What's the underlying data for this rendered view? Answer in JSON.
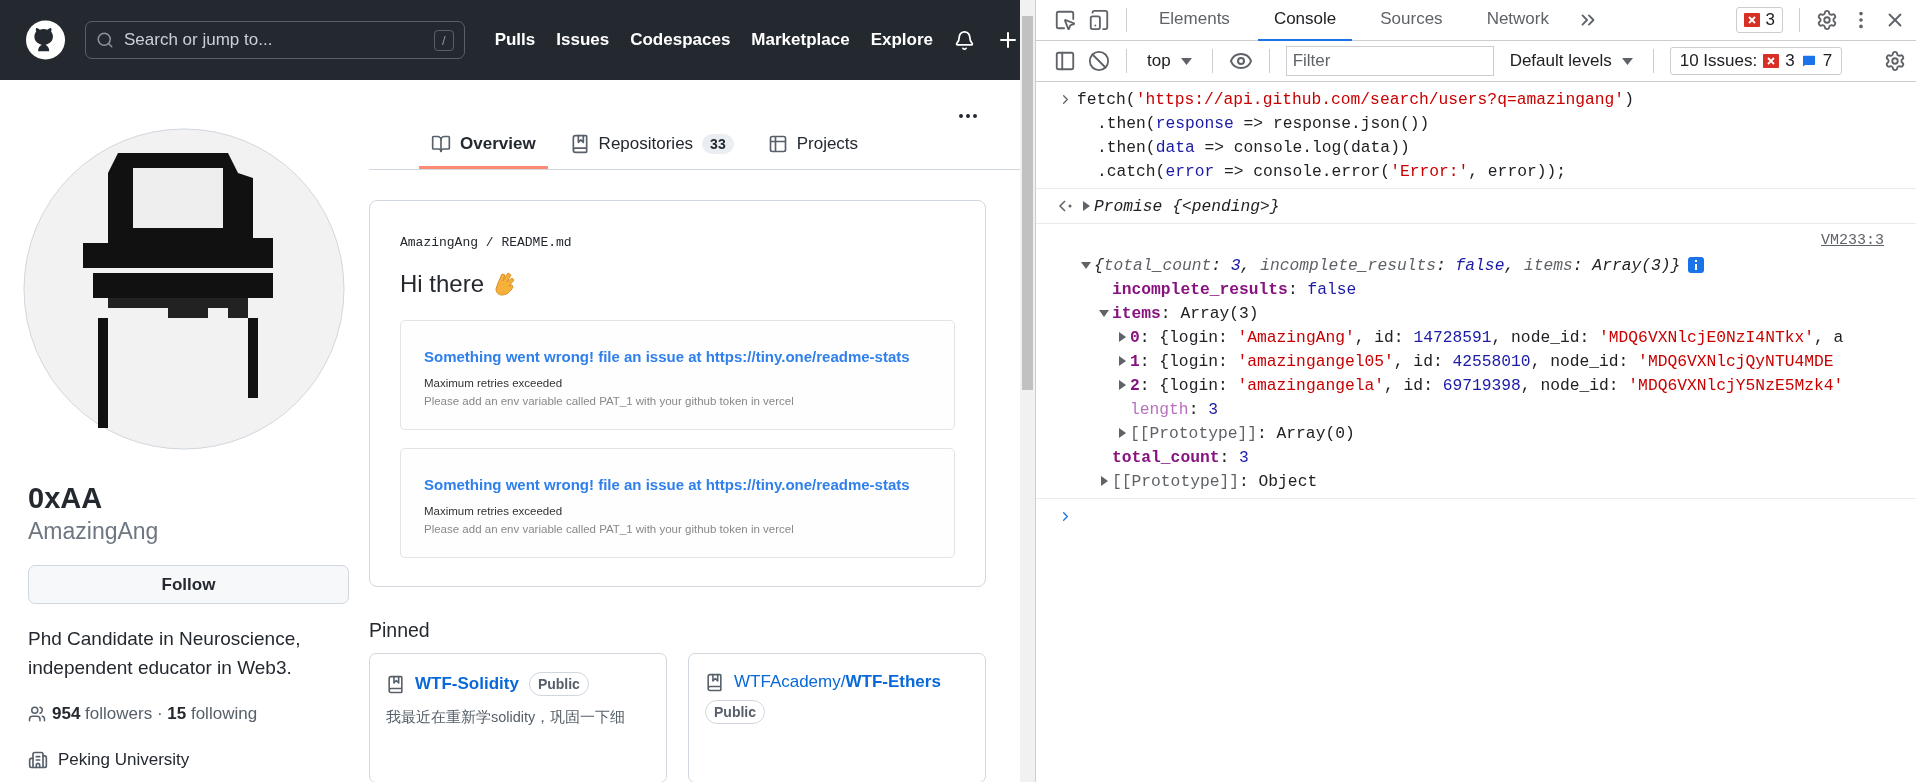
{
  "github": {
    "header": {
      "search_placeholder": "Search or jump to...",
      "search_key": "/",
      "nav": [
        "Pulls",
        "Issues",
        "Codespaces",
        "Marketplace",
        "Explore"
      ]
    },
    "tabs": [
      {
        "label": "Overview",
        "kind": "book",
        "selected": true
      },
      {
        "label": "Repositories",
        "kind": "repo",
        "count": "33",
        "selected": false
      },
      {
        "label": "Projects",
        "kind": "table",
        "selected": false
      }
    ],
    "profile": {
      "name": "0xAA",
      "login": "AmazingAng",
      "follow_button": "Follow",
      "bio": "Phd Candidate in Neuroscience, independent educator in Web3.",
      "follow_stats": "**954** followers · **15** following",
      "organization": "Peking University"
    },
    "readme": {
      "path": "AmazingAng / README.md",
      "heading": "Hi there",
      "stat_cards": [
        {
          "title": "Something went wrong! file an issue at https://tiny.one/readme-stats",
          "message": "Maximum retries exceeded",
          "hint": "Please add an env variable called PAT_1 with your github token in vercel"
        },
        {
          "title": "Something went wrong! file an issue at https://tiny.one/readme-stats",
          "message": "Maximum retries exceeded",
          "hint": "Please add an env variable called PAT_1 with your github token in vercel"
        }
      ]
    },
    "pinned": {
      "title": "Pinned",
      "repos": [
        {
          "name": "WTF-Solidity",
          "badge": "Public",
          "description": "我最近在重新学solidity，巩固一下细"
        },
        {
          "owner": "WTFAcademy/",
          "name": "WTF-Ethers",
          "badge": "Public"
        }
      ]
    }
  },
  "devtools": {
    "tabs": [
      {
        "label": "Elements",
        "selected": false
      },
      {
        "label": "Console",
        "selected": true
      },
      {
        "label": "Sources",
        "selected": false
      },
      {
        "label": "Network",
        "selected": false
      }
    ],
    "error_count": "3",
    "context": "top",
    "filter_placeholder": "Filter",
    "levels": "Default levels",
    "issues": {
      "label": "10 Issues:",
      "errors": "3",
      "messages": "7"
    },
    "console": {
      "command": [
        [
          {
            "text": "fetch(",
            "kind": "plain"
          },
          {
            "text": "'https://api.github.com/search/users?q=amazingang'",
            "kind": "string"
          },
          {
            "text": ")",
            "kind": "plain"
          }
        ],
        [
          {
            "text": ".then(",
            "kind": "plain"
          },
          {
            "text": "response",
            "kind": "param"
          },
          {
            "text": " => response.json())",
            "kind": "plain"
          }
        ],
        [
          {
            "text": ".then(",
            "kind": "plain"
          },
          {
            "text": "data",
            "kind": "param"
          },
          {
            "text": " => console.log(data))",
            "kind": "plain"
          }
        ],
        [
          {
            "text": ".catch(",
            "kind": "plain"
          },
          {
            "text": "error",
            "kind": "param"
          },
          {
            "text": " => console.error(",
            "kind": "plain"
          },
          {
            "text": "'Error:'",
            "kind": "string"
          },
          {
            "text": ", error));",
            "kind": "plain"
          }
        ]
      ],
      "result": {
        "expanded": false,
        "tokens": [
          {
            "text": "Promise {<pending>}",
            "kind": "p-plain"
          }
        ]
      },
      "log": {
        "source": "VM233:3",
        "tree": {
          "expanded": true,
          "info": true,
          "tokens": [
            {
              "text": "{",
              "kind": "p-plain"
            },
            {
              "text": "total_count",
              "kind": "p-key"
            },
            {
              "text": ": ",
              "kind": "p-plain"
            },
            {
              "text": "3",
              "kind": "p-num"
            },
            {
              "text": ", ",
              "kind": "p-plain"
            },
            {
              "text": "incomplete_results",
              "kind": "p-key"
            },
            {
              "text": ": ",
              "kind": "p-plain"
            },
            {
              "text": "false",
              "kind": "p-num"
            },
            {
              "text": ", ",
              "kind": "p-plain"
            },
            {
              "text": "items",
              "kind": "p-key"
            },
            {
              "text": ": Array(3)}",
              "kind": "p-plain"
            }
          ],
          "children": [
            {
              "tokens": [
                {
                  "text": "incomplete_results",
                  "kind": "prop"
                },
                {
                  "text": ": ",
                  "kind": "plain"
                },
                {
                  "text": "false",
                  "kind": "number"
                }
              ]
            },
            {
              "expanded": true,
              "tokens": [
                {
                  "text": "items",
                  "kind": "prop"
                },
                {
                  "text": ": Array(3)",
                  "kind": "plain"
                }
              ],
              "children": [
                {
                  "expanded": false,
                  "tokens": [
                    {
                      "text": "0",
                      "kind": "prop"
                    },
                    {
                      "text": ": {login: ",
                      "kind": "plain"
                    },
                    {
                      "text": "'AmazingAng'",
                      "kind": "string"
                    },
                    {
                      "text": ", id: ",
                      "kind": "plain"
                    },
                    {
                      "text": "14728591",
                      "kind": "number"
                    },
                    {
                      "text": ", node_id: ",
                      "kind": "plain"
                    },
                    {
                      "text": "'MDQ6VXNlcjE0NzI4NTkx'",
                      "kind": "string"
                    },
                    {
                      "text": ", a",
                      "kind": "plain"
                    }
                  ]
                },
                {
                  "expanded": false,
                  "tokens": [
                    {
                      "text": "1",
                      "kind": "prop"
                    },
                    {
                      "text": ": {login: ",
                      "kind": "plain"
                    },
                    {
                      "text": "'amazingangel05'",
                      "kind": "string"
                    },
                    {
                      "text": ", id: ",
                      "kind": "plain"
                    },
                    {
                      "text": "42558010",
                      "kind": "number"
                    },
                    {
                      "text": ", node_id: ",
                      "kind": "plain"
                    },
                    {
                      "text": "'MDQ6VXNlcjQyNTU4MDE",
                      "kind": "string"
                    }
                  ]
                },
                {
                  "expanded": false,
                  "tokens": [
                    {
                      "text": "2",
                      "kind": "prop"
                    },
                    {
                      "text": ": {login: ",
                      "kind": "plain"
                    },
                    {
                      "text": "'amazingangela'",
                      "kind": "string"
                    },
                    {
                      "text": ", id: ",
                      "kind": "plain"
                    },
                    {
                      "text": "69719398",
                      "kind": "number"
                    },
                    {
                      "text": ", node_id: ",
                      "kind": "plain"
                    },
                    {
                      "text": "'MDQ6VXNlcjY5NzE5Mzk4'",
                      "kind": "string"
                    }
                  ]
                },
                {
                  "tokens": [
                    {
                      "text": "length",
                      "kind": "prop-dim"
                    },
                    {
                      "text": ": ",
                      "kind": "plain"
                    },
                    {
                      "text": "3",
                      "kind": "number"
                    }
                  ]
                },
                {
                  "expanded": false,
                  "tokens": [
                    {
                      "text": "[[Prototype]]",
                      "kind": "proto"
                    },
                    {
                      "text": ": Array(0)",
                      "kind": "plain"
                    }
                  ]
                }
              ]
            },
            {
              "tokens": [
                {
                  "text": "total_count",
                  "kind": "prop"
                },
                {
                  "text": ": ",
                  "kind": "plain"
                },
                {
                  "text": "3",
                  "kind": "number"
                }
              ]
            },
            {
              "expanded": false,
              "tokens": [
                {
                  "text": "[[Prototype]]",
                  "kind": "proto"
                },
                {
                  "text": ": Object",
                  "kind": "plain"
                }
              ]
            }
          ]
        }
      }
    }
  }
}
